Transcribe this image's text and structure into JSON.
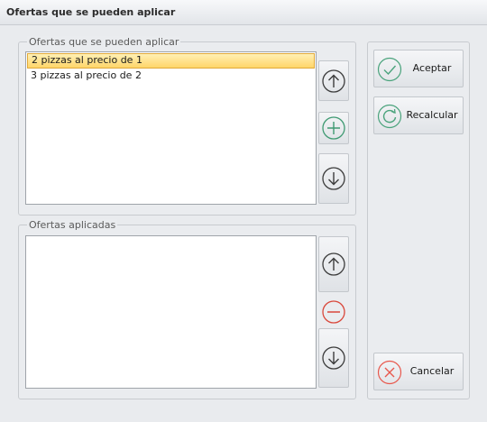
{
  "window": {
    "title": "Ofertas que se pueden aplicar"
  },
  "available": {
    "legend": "Ofertas que se pueden aplicar",
    "items": [
      "2 pizzas al precio de 1",
      "3 pizzas al precio de 2"
    ],
    "selected_index": 0
  },
  "applied": {
    "legend": "Ofertas aplicadas",
    "items": []
  },
  "actions": {
    "accept_label": "Aceptar",
    "recalc_label": "Recalcular",
    "cancel_label": "Cancelar"
  },
  "icons": {
    "move_up": "arrow-up-icon",
    "add": "plus-icon",
    "move_down": "arrow-down-icon",
    "remove": "minus-icon",
    "accept": "check-icon",
    "recalc": "refresh-icon",
    "cancel": "x-icon"
  },
  "colors": {
    "selection": "#ffd56a",
    "add_green": "#3f9a72",
    "remove_red": "#d9473a",
    "cancel_red": "#e8584d",
    "check_green": "#4aa37c"
  }
}
